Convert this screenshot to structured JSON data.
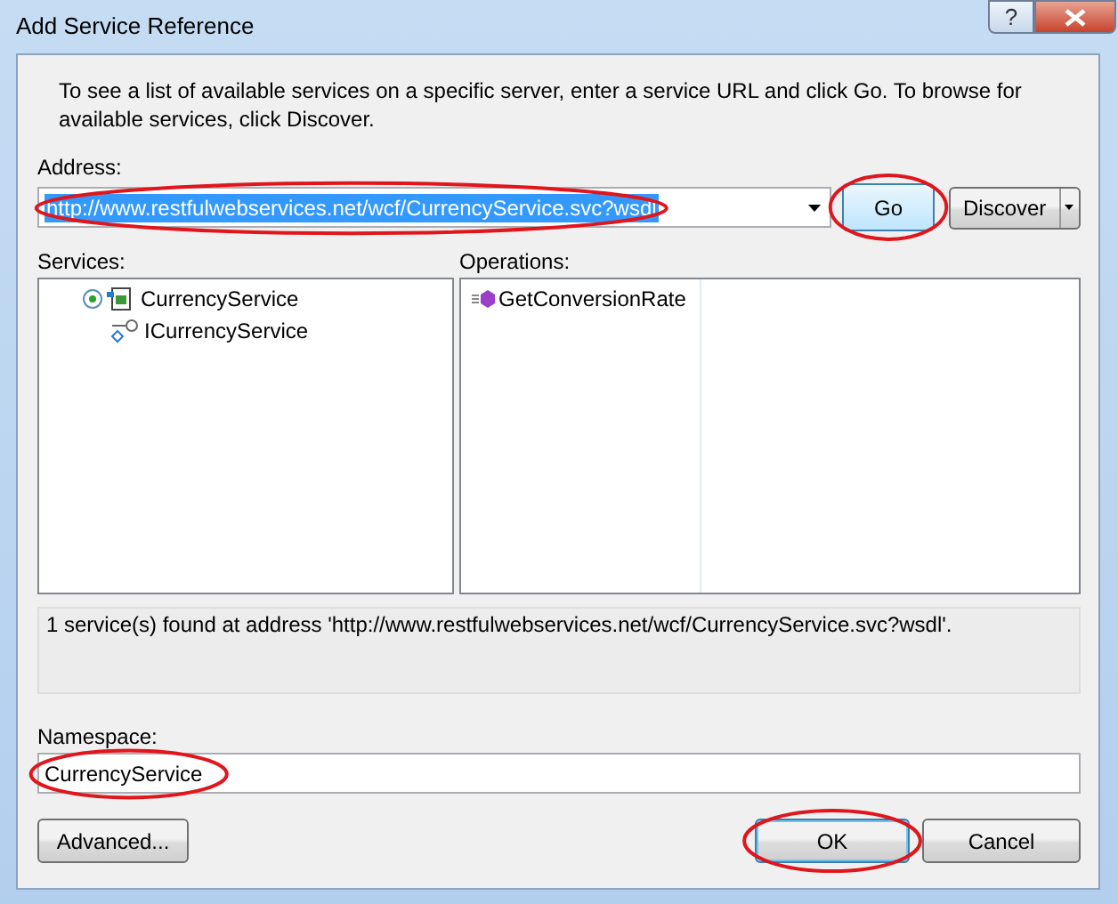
{
  "window": {
    "title": "Add Service Reference",
    "help": "?"
  },
  "intro": "To see a list of available services on a specific server, enter a service URL and click Go. To browse for available services, click Discover.",
  "address": {
    "label": "Address:",
    "value": "http://www.restfulwebservices.net/wcf/CurrencyService.svc?wsdl",
    "text_selected": true,
    "circled": true
  },
  "go_button": {
    "label": "Go",
    "circled": true
  },
  "discover_button": {
    "label": "Discover"
  },
  "services": {
    "label": "Services:",
    "items": [
      {
        "name": "CurrencyService",
        "kind": "service",
        "children": [
          {
            "name": "ICurrencyService",
            "kind": "contract"
          }
        ]
      }
    ]
  },
  "operations": {
    "label": "Operations:",
    "items": [
      "GetConversionRate"
    ]
  },
  "status": "1 service(s) found at address 'http://www.restfulwebservices.net/wcf/CurrencyService.svc?wsdl'.",
  "namespace": {
    "label": "Namespace:",
    "value": "CurrencyService",
    "circled": true
  },
  "footer_buttons": [
    {
      "label": "Advanced...",
      "kind": "left",
      "circled": false
    },
    {
      "label": "OK",
      "kind": "default",
      "circled": true
    },
    {
      "label": "Cancel",
      "kind": "normal",
      "circled": false
    }
  ]
}
